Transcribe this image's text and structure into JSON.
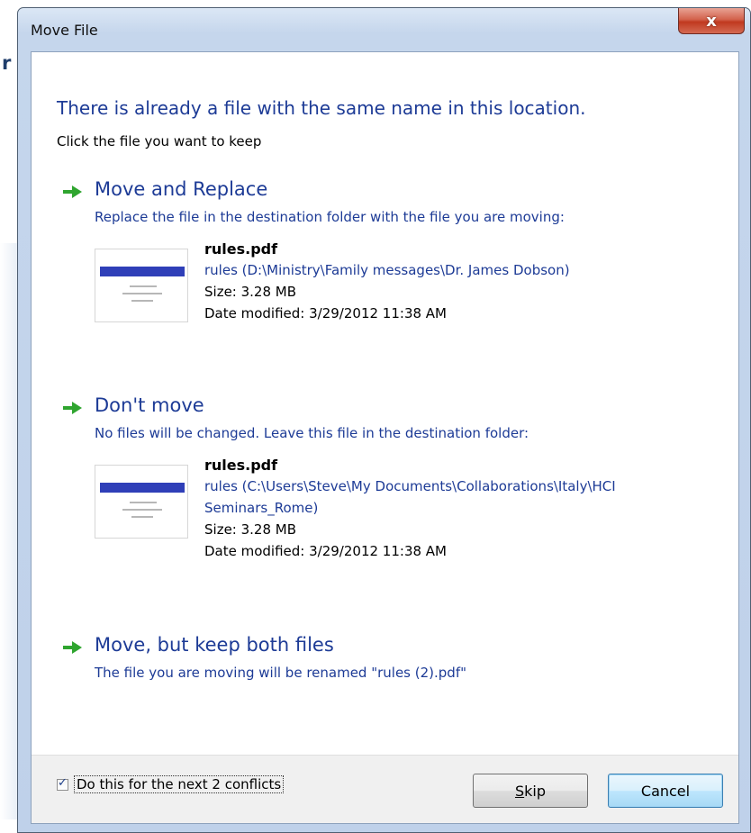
{
  "background": {
    "fragment_text": "r"
  },
  "window": {
    "title": "Move File",
    "close_glyph": "x"
  },
  "dialog": {
    "heading": "There is already a file with the same name in this location.",
    "instruction": "Click the file you want to keep"
  },
  "options": [
    {
      "title": "Move and Replace",
      "description": "Replace the file in the destination folder with the file you are moving:",
      "file": {
        "name": "rules.pdf",
        "path": "rules (D:\\Ministry\\Family messages\\Dr. James Dobson)",
        "size": "Size: 3.28 MB",
        "date": "Date modified: 3/29/2012 11:38 AM"
      }
    },
    {
      "title": "Don't move",
      "description": "No files will be changed. Leave this file in the destination folder:",
      "file": {
        "name": "rules.pdf",
        "path": "rules (C:\\Users\\Steve\\My Documents\\Collaborations\\Italy\\HCI Seminars_Rome)",
        "size": "Size: 3.28 MB",
        "date": "Date modified: 3/29/2012 11:38 AM"
      }
    },
    {
      "title": "Move, but keep both files",
      "description": "The file you are moving will be renamed \"rules (2).pdf\""
    }
  ],
  "footer": {
    "checkbox_checked": true,
    "checkbox_label": "Do this for the next 2 conflicts",
    "skip_label_mnemonic": "S",
    "skip_label_rest": "kip",
    "cancel_label": "Cancel"
  },
  "colors": {
    "link_blue": "#1d3b96",
    "arrow_green": "#2fa52f",
    "close_red": "#c0391f"
  }
}
